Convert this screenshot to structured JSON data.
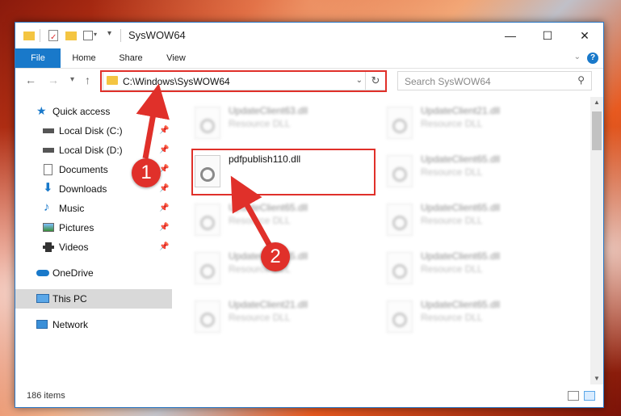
{
  "window": {
    "title": "SysWOW64",
    "controls": {
      "minimize": "—",
      "maximize": "☐",
      "close": "✕"
    }
  },
  "ribbon": {
    "tabs": [
      {
        "label": "File"
      },
      {
        "label": "Home"
      },
      {
        "label": "Share"
      },
      {
        "label": "View"
      }
    ],
    "help": "?"
  },
  "address": {
    "path": "C:\\Windows\\SysWOW64",
    "search_placeholder": "Search SysWOW64"
  },
  "nav": {
    "items": [
      {
        "label": "Quick access",
        "icon": "star-icon",
        "pinned": false
      },
      {
        "label": "Local Disk (C:)",
        "icon": "drive-icon",
        "pinned": true
      },
      {
        "label": "Local Disk (D:)",
        "icon": "drive-icon",
        "pinned": true
      },
      {
        "label": "Documents",
        "icon": "document-icon",
        "pinned": true
      },
      {
        "label": "Downloads",
        "icon": "download-icon",
        "pinned": true
      },
      {
        "label": "Music",
        "icon": "music-icon",
        "pinned": true
      },
      {
        "label": "Pictures",
        "icon": "pictures-icon",
        "pinned": true
      },
      {
        "label": "Videos",
        "icon": "video-icon",
        "pinned": true
      },
      {
        "label": "OneDrive",
        "icon": "cloud-icon",
        "pinned": false
      },
      {
        "label": "This PC",
        "icon": "computer-icon",
        "pinned": false,
        "selected": true
      },
      {
        "label": "Network",
        "icon": "network-icon",
        "pinned": false
      }
    ]
  },
  "files": {
    "left": [
      {
        "name": "UpdateClient63.dll",
        "type": "Resource DLL"
      },
      {
        "name": "pdfpublish110.dll",
        "type": ""
      },
      {
        "name": "UpdateClient65.dll",
        "type": "Resource DLL"
      },
      {
        "name": "UpdateClient65.dll",
        "type": "Resource DLL"
      },
      {
        "name": "UpdateClient21.dll",
        "type": "Resource DLL"
      }
    ],
    "right": [
      {
        "name": "UpdateClient21.dll",
        "type": "Resource DLL"
      },
      {
        "name": "UpdateClient65.dll",
        "type": "Resource DLL"
      },
      {
        "name": "UpdateClient65.dll",
        "type": "Resource DLL"
      },
      {
        "name": "UpdateClient65.dll",
        "type": "Resource DLL"
      },
      {
        "name": "UpdateClient65.dll",
        "type": "Resource DLL"
      }
    ]
  },
  "status": {
    "count": "186 items"
  },
  "annotations": {
    "step1": "1",
    "step2": "2"
  },
  "colors": {
    "accent": "#1979ca",
    "highlight": "#e0302a"
  }
}
